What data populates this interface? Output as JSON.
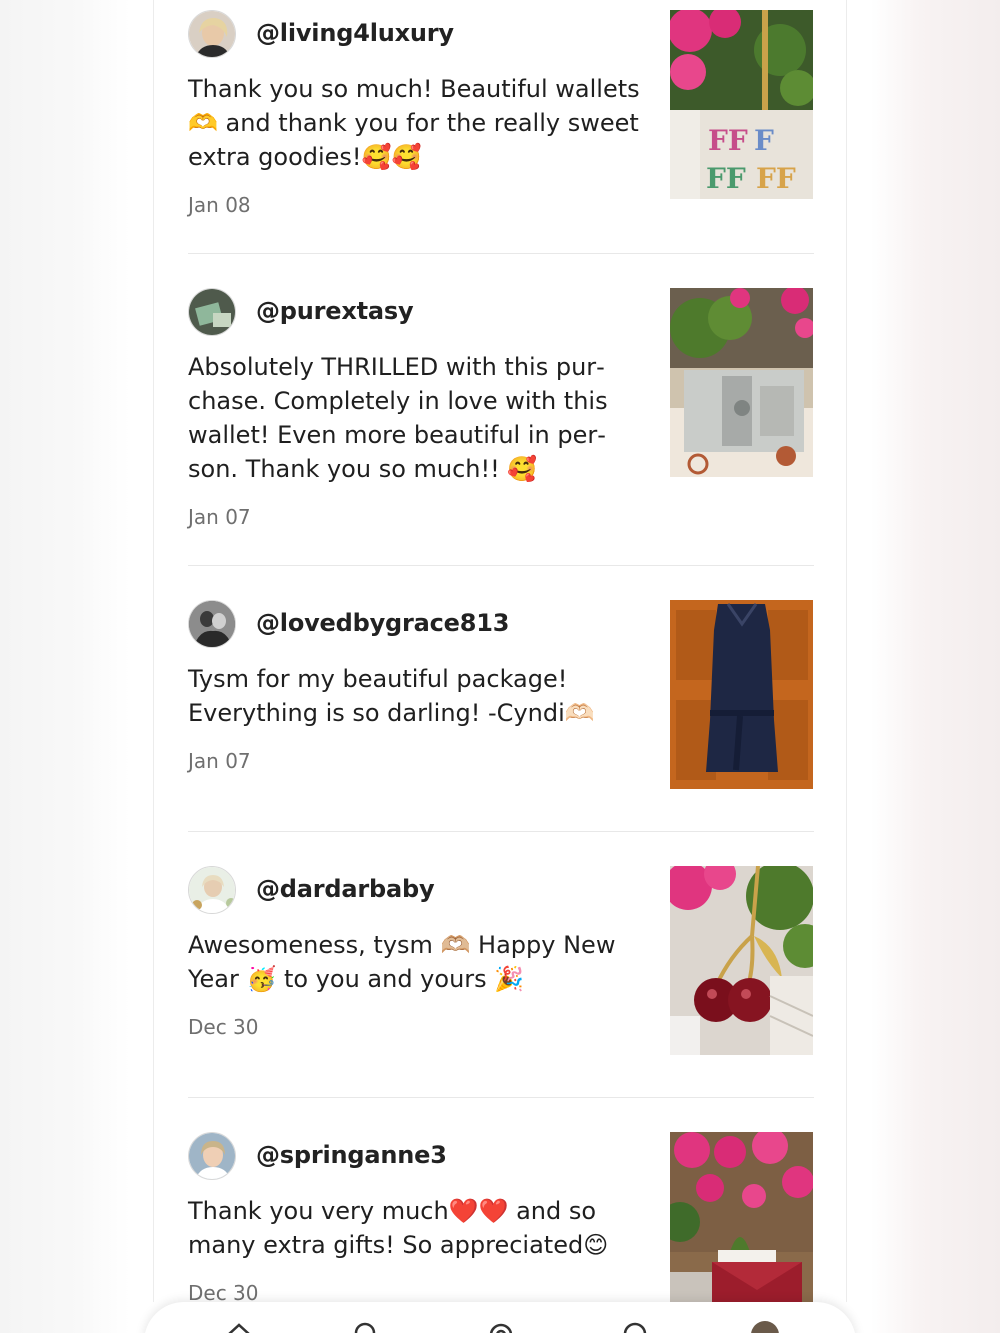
{
  "reviews": [
    {
      "username": "@living4luxury",
      "message": "Thank you so much! Beautiful wallets 🫶 and thank you for the really sweet extra goodies!🥰🥰",
      "date": "Jan 08"
    },
    {
      "username": "@purextasy",
      "message": "Absolutely THRILLED with this pur­chase. Completely in love with this wallet! Even more beautiful in per­son. Thank you so much!! 🥰",
      "date": "Jan 07"
    },
    {
      "username": "@lovedbygrace813",
      "message": "Tysm for my beautiful package! Everything is so darling! -Cyndi🫶🏻",
      "date": "Jan 07"
    },
    {
      "username": "@dardarbaby",
      "message": "Awesomeness, tysm 🫶🏼 Happy New Year 🥳 to you and yours 🎉",
      "date": "Dec 30"
    },
    {
      "username": "@springanne3",
      "message": "Thank you very much❤️❤️ and so many extra gifts! So appreciated😊",
      "date": "Dec 30"
    }
  ],
  "bottom_nav": {
    "icons": [
      "home-icon",
      "search-icon",
      "sell-icon",
      "news-icon",
      "profile-avatar-icon"
    ]
  },
  "colors": {
    "text": "#1f1f1f",
    "muted": "#6f6f6f",
    "divider": "#e8e8e8"
  }
}
